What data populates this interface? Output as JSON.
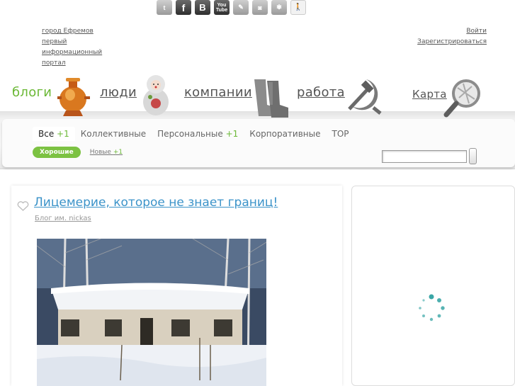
{
  "social": {
    "icons": [
      {
        "name": "twitter-icon",
        "glyph": "t"
      },
      {
        "name": "facebook-icon",
        "glyph": "f"
      },
      {
        "name": "vkontakte-icon",
        "glyph": "B"
      },
      {
        "name": "youtube-icon",
        "glyph": "You"
      },
      {
        "name": "livejournal-icon",
        "glyph": "✎"
      },
      {
        "name": "rss-icon",
        "glyph": "◙"
      },
      {
        "name": "liveinternet-icon",
        "glyph": "✾"
      },
      {
        "name": "walker-icon",
        "glyph": "🚶"
      }
    ],
    "youtube_line2": "Tube"
  },
  "header": {
    "tagline": [
      "город Ефремов",
      "первый информационный",
      "портал"
    ],
    "login": "Войти",
    "register": "Зарегистрироваться"
  },
  "nav": {
    "items": [
      {
        "label": "блоги",
        "icon": "samovar-icon"
      },
      {
        "label": "люди",
        "icon": "matryoshka-icon"
      },
      {
        "label": "компании",
        "icon": "valenki-icon"
      },
      {
        "label": "работа",
        "icon": "hammer-sickle-icon"
      },
      {
        "label": "Карта",
        "icon": "magnifier-map-icon"
      }
    ]
  },
  "tabs": {
    "all": "Все",
    "all_count": "+1",
    "collective": "Коллективные",
    "personal": "Персональные",
    "personal_count": "+1",
    "corporate": "Корпоративные",
    "top": "TOP"
  },
  "subtabs": {
    "good": "Хорошие",
    "new": "Новые",
    "new_count": "+1"
  },
  "post": {
    "title": "Лицемерие, которое не знает границ!",
    "meta": "Блог им. nickas"
  },
  "colors": {
    "accent": "#6bb836",
    "link": "#3b93c9",
    "spinner": "#3aa6a6"
  }
}
